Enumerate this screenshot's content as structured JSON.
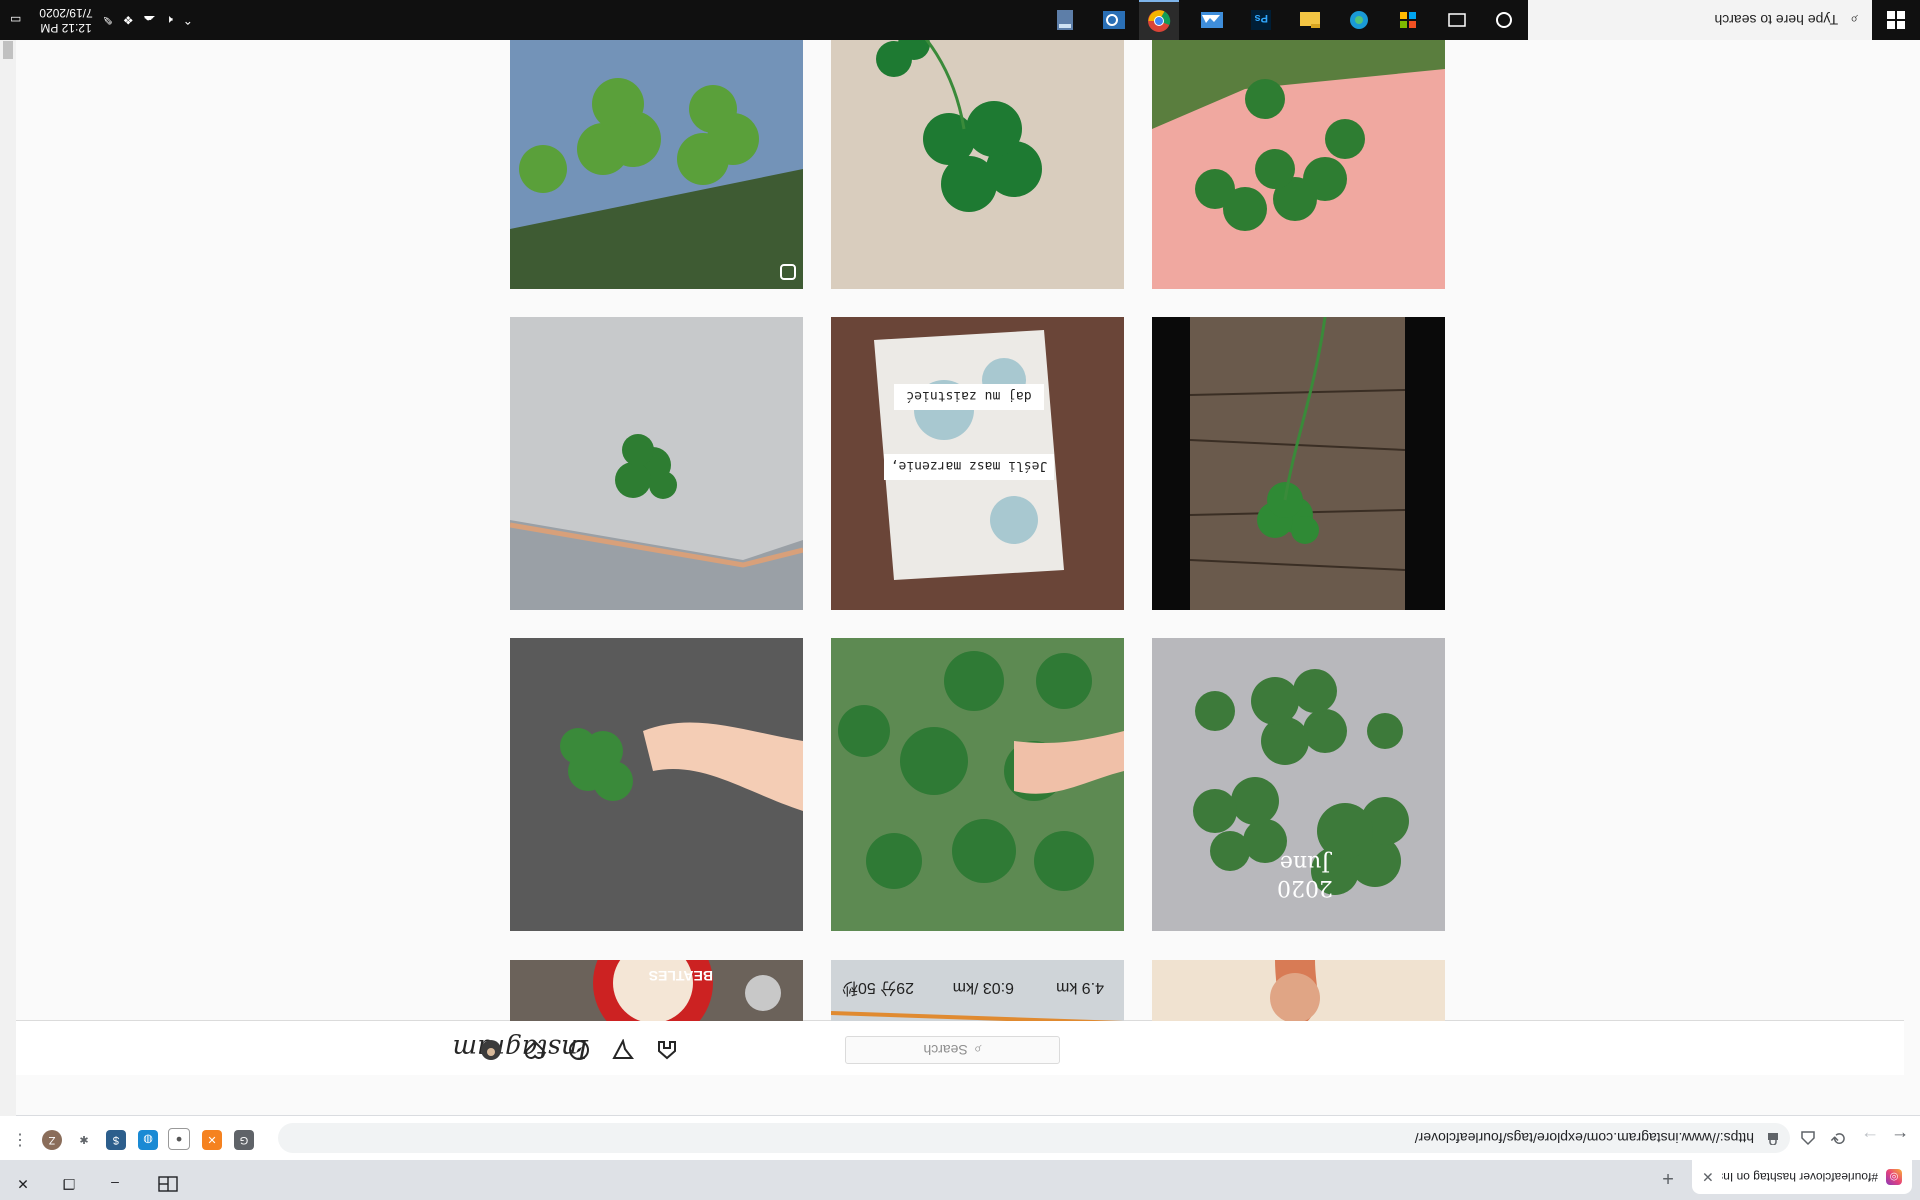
{
  "browser": {
    "tab_title": "#fourleafclover hashtag on Insta",
    "tab_close": "✕",
    "new_tab": "+",
    "url": "https://www.instagram.com/explore/tags/fourleafclover/",
    "extension_letters": [
      "Z"
    ],
    "window_minimize": "–",
    "window_restore": "❐",
    "window_close": "✕"
  },
  "instagram": {
    "logo": "Instagram",
    "search_placeholder": "Search"
  },
  "grid": {
    "rows": [
      [
        "Clover leaves on denim",
        "Four-leaf clover on sand",
        "Clovers in palm"
      ],
      [
        "Clover on snow",
        "Scrapbook card: Jeśli masz marzenie, daj mu zaistnieć",
        "Clover on wooden plank"
      ],
      [
        "Fingers holding clover",
        "Hand picking clover",
        "Pressed clovers June 2020"
      ],
      [
        "Beatles button",
        "Running app stats 4.9 km 6:03 /km",
        "Hand holding clover"
      ]
    ],
    "overlay_texts": {
      "card_line1": "Jeśli masz marzenie,",
      "card_line2": "daj mu zaistnieć",
      "pressed_label_line1": "June",
      "pressed_label_line2": "2020",
      "run_distance": "4.9 km",
      "run_pace": "6:03 /km",
      "run_time": "29分 50秒",
      "beatles": "BEATLES"
    }
  },
  "taskbar": {
    "search_placeholder": "Type here to search",
    "time": "12:12 PM",
    "date": "7/19/2020",
    "pinned": [
      "cortana",
      "task-view",
      "store",
      "edge",
      "file-explorer",
      "photoshop",
      "onedrive-weather",
      "chrome",
      "outlook",
      "calculator"
    ]
  },
  "colors": {
    "ig_bg": "#fafafa",
    "taskbar": "#101010",
    "chrome_tabstrip": "#dee1e6",
    "clover_green": "#2f8f3a"
  }
}
